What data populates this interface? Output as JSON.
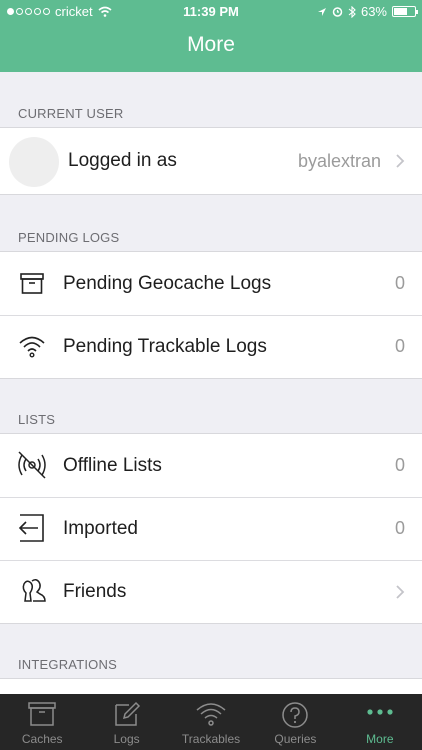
{
  "status_bar": {
    "carrier": "cricket",
    "time": "11:39 PM",
    "battery": "63%",
    "battery_level": 0.63
  },
  "header": {
    "title": "More"
  },
  "sections": {
    "current_user": {
      "label": "CURRENT USER",
      "row_label": "Logged in as",
      "username": "byalextran"
    },
    "pending_logs": {
      "label": "PENDING LOGS",
      "items": [
        {
          "label": "Pending Geocache Logs",
          "count": "0",
          "icon": "box-icon"
        },
        {
          "label": "Pending Trackable Logs",
          "count": "0",
          "icon": "wireless-signal-icon"
        }
      ]
    },
    "lists": {
      "label": "LISTS",
      "items": [
        {
          "label": "Offline Lists",
          "count": "0",
          "icon": "offline-icon"
        },
        {
          "label": "Imported",
          "count": "0",
          "icon": "import-icon"
        },
        {
          "label": "Friends",
          "icon": "friends-icon"
        }
      ]
    },
    "integrations": {
      "label": "INTEGRATIONS"
    }
  },
  "tabbar": {
    "items": [
      {
        "label": "Caches",
        "icon": "box-icon",
        "active": false
      },
      {
        "label": "Logs",
        "icon": "pencil-icon",
        "active": false
      },
      {
        "label": "Trackables",
        "icon": "wireless-signal-icon",
        "active": false
      },
      {
        "label": "Queries",
        "icon": "question-icon",
        "active": false
      },
      {
        "label": "More",
        "icon": "ellipsis-icon",
        "active": true
      }
    ]
  },
  "colors": {
    "accent": "#5ebc91",
    "tabbar_bg": "#262626",
    "background": "#efeff4"
  }
}
